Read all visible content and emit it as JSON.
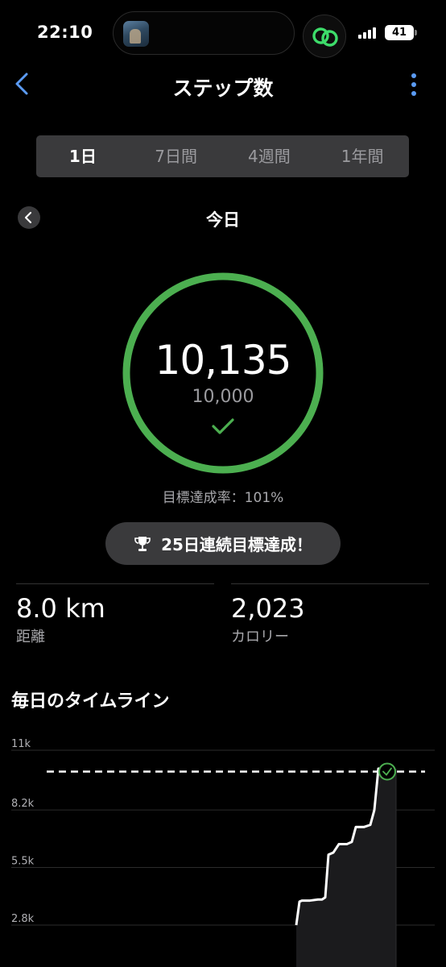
{
  "status_bar": {
    "time": "22:10",
    "battery": "41"
  },
  "header": {
    "title": "ステップ数"
  },
  "tabs": [
    {
      "label": "1日",
      "active": true
    },
    {
      "label": "7日間",
      "active": false
    },
    {
      "label": "4週間",
      "active": false
    },
    {
      "label": "1年間",
      "active": false
    }
  ],
  "day": {
    "title": "今日"
  },
  "summary": {
    "steps": "10,135",
    "goal": "10,000",
    "achievement_rate": "目標達成率：101%",
    "progress": 1.01,
    "ring_color": "#4caf50"
  },
  "streak": {
    "label": "25日連続目標達成！"
  },
  "stats": [
    {
      "value": "8.0 km",
      "label": "距離"
    },
    {
      "value": "2,023",
      "label": "カロリー"
    }
  ],
  "timeline": {
    "title": "毎日のタイムライン"
  },
  "chart_data": {
    "type": "line",
    "y_ticks": [
      "11k",
      "8.2k",
      "5.5k",
      "2.8k"
    ],
    "y_tick_values": [
      11000,
      8200,
      5500,
      2800
    ],
    "goal_line": 10000,
    "goal_line_style": "dashed",
    "goal_reached_marker": true,
    "x": [
      0,
      1,
      2,
      3,
      4,
      5,
      6,
      7,
      8,
      9,
      10,
      11,
      12,
      13,
      14,
      15,
      16
    ],
    "values": [
      2800,
      3900,
      3950,
      3950,
      4000,
      4000,
      4100,
      6100,
      6200,
      6600,
      6600,
      6700,
      7400,
      7400,
      7500,
      8200,
      10135
    ]
  }
}
